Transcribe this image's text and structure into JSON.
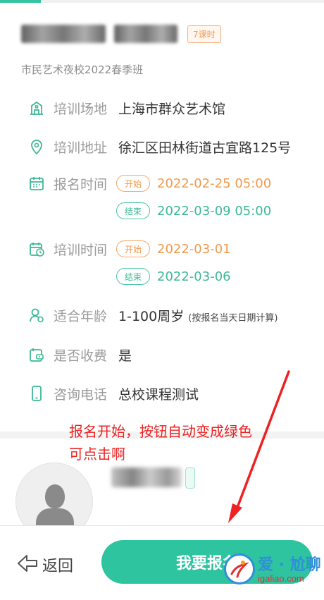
{
  "course": {
    "hours_badge": "7课时",
    "school": "市民艺术夜校2022春季班"
  },
  "info": {
    "venue_label": "培训场地",
    "venue_value": "上海市群众艺术馆",
    "address_label": "培训地址",
    "address_value": "徐汇区田林街道古宜路125号",
    "signup_label": "报名时间",
    "signup_start_tag": "开始",
    "signup_start": "2022-02-25 05:00",
    "signup_end_tag": "结束",
    "signup_end": "2022-03-09 05:00",
    "training_label": "培训时间",
    "training_start_tag": "开始",
    "training_start": "2022-03-01",
    "training_end_tag": "结束",
    "training_end": "2022-03-06",
    "age_label": "适合年龄",
    "age_value": "1-100周岁",
    "age_note": "(按报名当天日期计算)",
    "fee_label": "是否收费",
    "fee_value": "是",
    "phone_label": "咨询电话",
    "phone_value": "总校课程测试"
  },
  "annotation": {
    "line1": "报名开始，按钮自动变成绿色",
    "line2": "可点击啊"
  },
  "footer": {
    "back_label": "返回",
    "signup_label": "我要报名"
  },
  "watermark": {
    "text": "爱 · 尬聊",
    "url": "igaliao.com"
  },
  "colors": {
    "accent": "#2ec4a0",
    "start": "#ef9a4c",
    "annotation": "#ee2222"
  }
}
